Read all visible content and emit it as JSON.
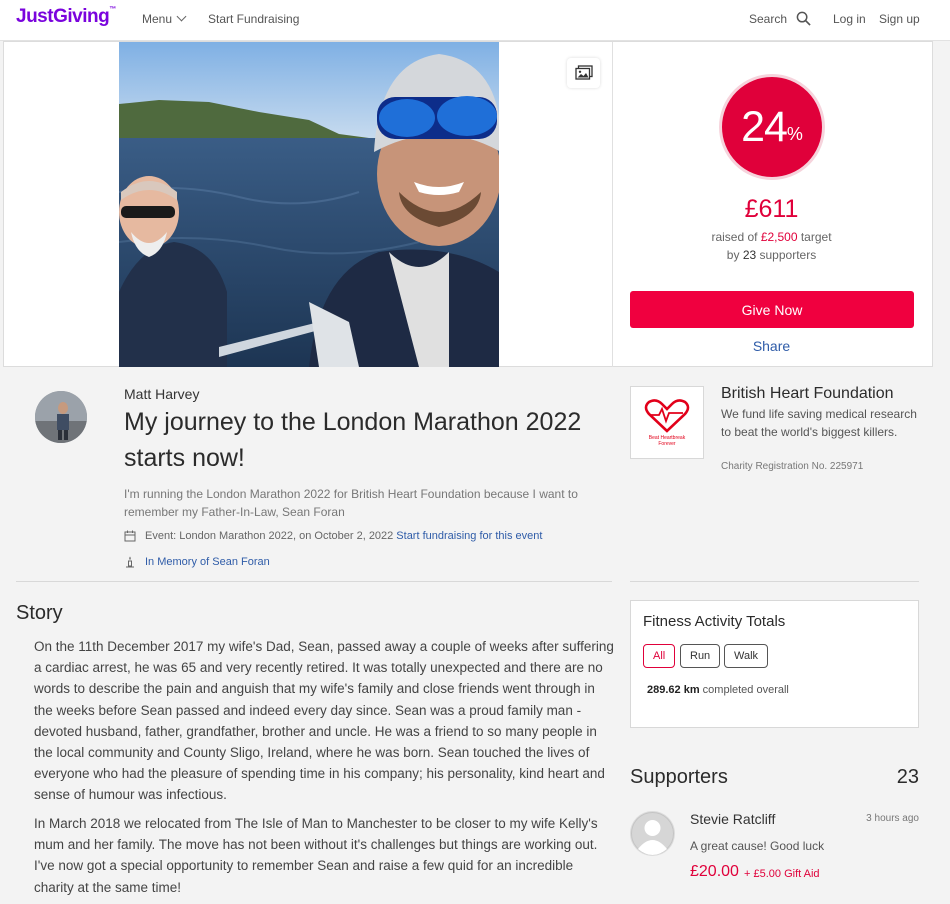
{
  "nav": {
    "logo": "JustGiving",
    "logo_mark": "™",
    "menu_label": "Menu",
    "start_fundraising": "Start Fundraising",
    "search_label": "Search",
    "login": "Log in",
    "signup": "Sign up"
  },
  "progress": {
    "percent": "24",
    "percent_symbol": "%",
    "raised": "£611",
    "raised_prefix": "raised of ",
    "target": "£2,500",
    "target_suffix": " target",
    "supporters_prefix": "by ",
    "supporters_count": "23",
    "supporters_suffix": " supporters",
    "give_button": "Give Now",
    "share": "Share"
  },
  "fundraiser": {
    "owner": "Matt Harvey",
    "title": "My journey to the London Marathon 2022 starts now!",
    "summary": "I'm running the London Marathon 2022 for British Heart Foundation because I want to remember my Father-In-Law, Sean Foran",
    "event_text": "Event: London Marathon 2022, on October 2, 2022",
    "event_link": "Start fundraising for this event",
    "memory": "In Memory of Sean Foran"
  },
  "charity": {
    "name": "British Heart Foundation",
    "description": "We fund life saving medical research to beat the world's biggest killers.",
    "registration": "Charity Registration No. 225971",
    "logo_text": "Beat Heartbreak Forever"
  },
  "story": {
    "heading": "Story",
    "paragraphs": [
      "On the 11th December 2017 my wife's Dad, Sean, passed away a couple of weeks after suffering a cardiac arrest, he was 65 and very recently retired. It was totally unexpected and there are no words to describe the pain and anguish that my wife's family and close friends went through in the weeks before Sean passed and indeed every day since. Sean was a proud family man - devoted husband, father, grandfather, brother and uncle. He was a friend to so many people in the local community and County Sligo, Ireland, where he was born. Sean touched the lives of everyone who had the pleasure of spending time in his company; his personality, kind heart and sense of humour was infectious.",
      "In March 2018 we relocated from The Isle of Man to Manchester to be closer to my wife Kelly's mum and her family. The move has not been without it's challenges but things are working out. I've now got a special opportunity to remember Sean and raise a few quid for an incredible charity at the same time!"
    ]
  },
  "fitness": {
    "title": "Fitness Activity Totals",
    "filters": [
      "All",
      "Run",
      "Walk"
    ],
    "selected_filter": "All",
    "distance": "289.62 km",
    "distance_suffix": " completed overall"
  },
  "supporters": {
    "heading": "Supporters",
    "count": "23",
    "items": [
      {
        "name": "Stevie Ratcliff",
        "time": "3 hours ago",
        "message": "A great cause! Good luck",
        "amount": "£20.00",
        "gift_aid": "+ £5.00 Gift Aid"
      }
    ]
  },
  "colors": {
    "brand": "#7a04dd",
    "accent": "#e0003a",
    "link": "#2f5ca8"
  }
}
